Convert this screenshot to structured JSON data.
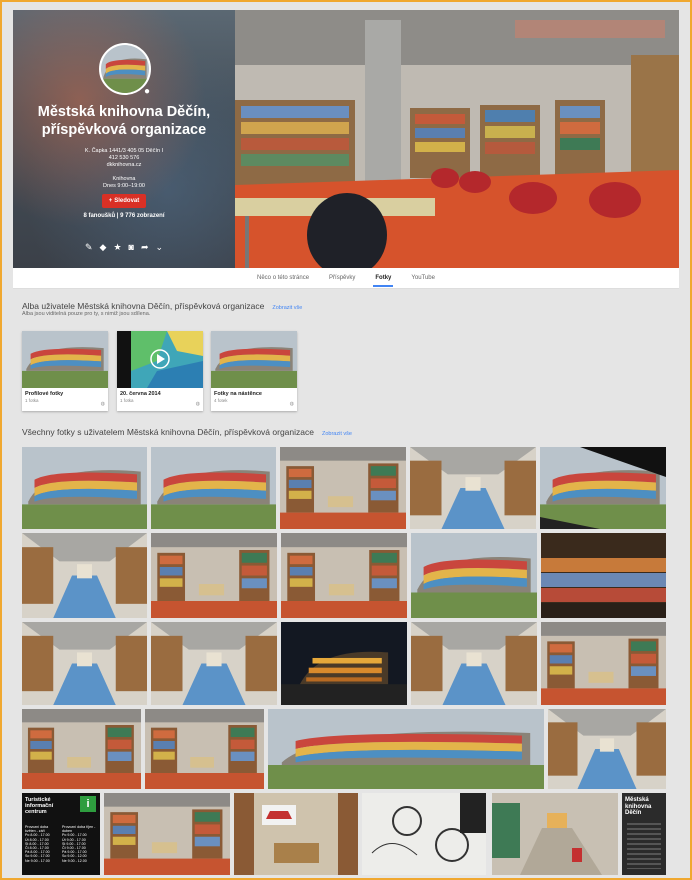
{
  "page": {
    "name": "Městská knihovna Děčín, příspěvková organizace",
    "address": "K. Čapka 1441/3 405 05 Děčín I",
    "phone": "412 530 576",
    "website": "dkknihovna.cz",
    "hours_label": "Knihovna",
    "hours_value": "Dnes 9:00–19:00",
    "follow_label": "Sledovat",
    "stats": "8 fanoušků | 9 776 zobrazení"
  },
  "tabs": [
    "Něco o této stránce",
    "Příspěvky",
    "Fotky",
    "YouTube"
  ],
  "active_tab": "Fotky",
  "albums_section": {
    "title": "Alba uživatele Městská knihovna Děčín, příspěvková organizace",
    "link": "Zobrazit vše",
    "subtitle": "Alba jsou viditelná pouze pro ty, s nimiž jsou sdílena."
  },
  "albums": [
    {
      "name": "Profilové fotky",
      "count": "1 fotka"
    },
    {
      "name": "20. června 2014",
      "count": "1 fotka"
    },
    {
      "name": "Fotky na nástěnce",
      "count": "4 fotek"
    }
  ],
  "photos_section": {
    "title": "Všechny fotky s uživatelem Městská knihovna Děčín, příspěvková organizace",
    "link": "Zobrazit vše"
  },
  "info_centre_sign": {
    "title": "Turistické informační centrum",
    "icon_letter": "i",
    "col1_head": "Provozní doba květen - září",
    "col2_head": "Provozní doba říjen - duben",
    "rows": [
      [
        "Po 8.00 - 17.00",
        "Po 9.00 - 17.00"
      ],
      [
        "Út 8.00 - 17.00",
        "Út 9.00 - 17.00"
      ],
      [
        "St 8.00 - 17.00",
        "St 9.00 - 17.00"
      ],
      [
        "Čt 8.00 - 17.00",
        "Čt 9.00 - 17.00"
      ],
      [
        "Pá 8.00 - 17.00",
        "Pá 9.00 - 17.00"
      ],
      [
        "So 9.00 - 17.00",
        "So 9.00 - 12.00"
      ],
      [
        "Ne 9.00 - 17.00",
        "Ne 9.00 - 12.00"
      ]
    ]
  },
  "poster": {
    "title": "Městská knihovna Děčín"
  },
  "colors": {
    "accent": "#4285f4",
    "follow": "#d93025",
    "frame": "#f0a830"
  }
}
